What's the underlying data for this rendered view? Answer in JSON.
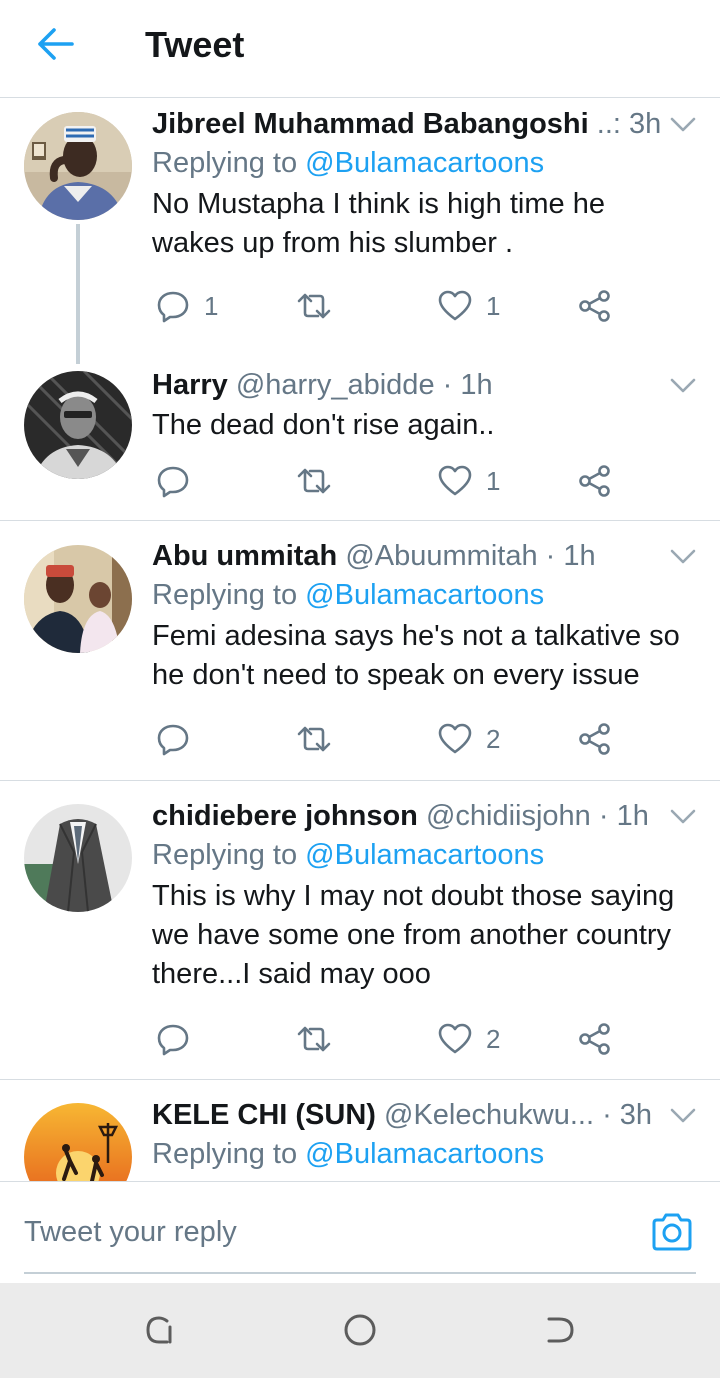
{
  "header": {
    "title": "Tweet",
    "back_icon": "arrow-left-icon",
    "accent": "#1da1f2"
  },
  "tweets": [
    {
      "name": "Jibreel Muhammad Babangoshi",
      "handle": "..:",
      "time": "3h",
      "replying_label": "Replying to",
      "replying_to": "@Bulamacartoons",
      "text_lines": [
        "No Mustapha I think is high time he",
        "wakes up from his slumber ."
      ],
      "replies": "1",
      "retweets": "",
      "likes": "1"
    },
    {
      "name": "Harry",
      "handle": "@harry_abidde",
      "time": "1h",
      "text_lines": [
        "The dead don't rise again.."
      ],
      "replies": "",
      "retweets": "",
      "likes": "1"
    },
    {
      "name": "Abu ummitah",
      "handle": "@Abuummitah",
      "time": "1h",
      "replying_label": "Replying to",
      "replying_to": "@Bulamacartoons",
      "text_lines": [
        "Femi adesina says he's not a talkative so",
        "he don't need to speak on every issue"
      ],
      "replies": "",
      "retweets": "",
      "likes": "2"
    },
    {
      "name": "chidiebere johnson",
      "handle": "@chidiisjohn",
      "time": "1h",
      "replying_label": "Replying to",
      "replying_to": "@Bulamacartoons",
      "text_lines": [
        "This is why I may not doubt those saying",
        "we have some one from another country",
        "there...I said may ooo"
      ],
      "replies": "",
      "retweets": "",
      "likes": "2"
    },
    {
      "name": "KELE CHI (SUN)",
      "handle": "@Kelechukwu...",
      "time": "3h",
      "replying_label": "Replying to",
      "replying_to": "@Bulamacartoons"
    }
  ],
  "reply_box": {
    "placeholder": "Tweet your reply",
    "icon": "camera-icon"
  },
  "system_nav": {
    "icons": [
      "recent-apps-icon",
      "home-icon",
      "back-icon"
    ]
  }
}
